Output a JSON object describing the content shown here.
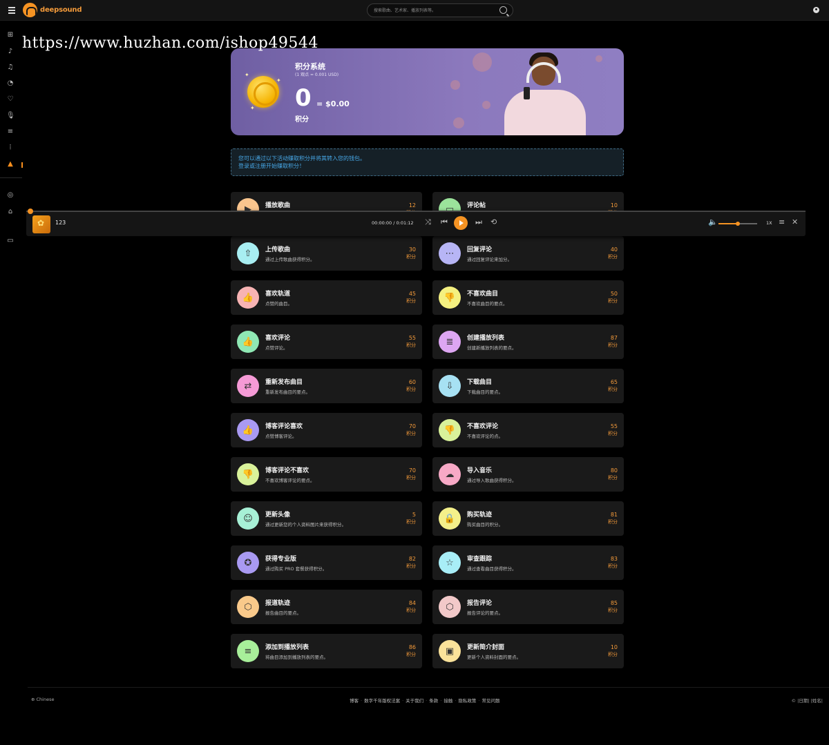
{
  "app": {
    "name": "deepsound"
  },
  "search": {
    "placeholder": "搜索歌曲、艺术家、播放列表等。"
  },
  "watermark": "https://www.huzhan.com/ishop49544",
  "hero": {
    "title": "积分系统",
    "subtitle": "(1 观点 = 0.001 USD)",
    "points": "0",
    "usd": "= $0.00",
    "label": "积分"
  },
  "info": {
    "line1": "您可以通过以下活动赚取积分并将其转入您的钱包。",
    "line2": "登录或注册开始赚取积分！"
  },
  "cards": [
    {
      "title": "播放歌曲",
      "desc": "",
      "points": "12",
      "unit": "积分",
      "icon": "play-icon",
      "color": "#f9c58e"
    },
    {
      "title": "评论帖",
      "desc": "",
      "points": "10",
      "unit": "积分",
      "icon": "comment-icon",
      "color": "#9be39b"
    },
    {
      "title": "上传歌曲",
      "desc": "通过上传歌曲获得积分。",
      "points": "30",
      "unit": "积分",
      "icon": "upload-icon",
      "color": "#a8eef2"
    },
    {
      "title": "回复评论",
      "desc": "通过回复评论来加分。",
      "points": "40",
      "unit": "积分",
      "icon": "reply-icon",
      "color": "#b7b5f5"
    },
    {
      "title": "喜欢轨道",
      "desc": "点赞的曲目。",
      "points": "45",
      "unit": "积分",
      "icon": "thumbs-up-icon",
      "color": "#f7b3b3"
    },
    {
      "title": "不喜欢曲目",
      "desc": "不喜欢曲目的要点。",
      "points": "50",
      "unit": "积分",
      "icon": "thumbs-down-icon",
      "color": "#f4f080"
    },
    {
      "title": "喜欢评论",
      "desc": "点赞评论。",
      "points": "55",
      "unit": "积分",
      "icon": "thumbs-up-icon",
      "color": "#8fe8b4"
    },
    {
      "title": "创建播放列表",
      "desc": "创建新播放列表的要点。",
      "points": "87",
      "unit": "积分",
      "icon": "playlist-icon",
      "color": "#dda6f2"
    },
    {
      "title": "重新发布曲目",
      "desc": "重新发布曲目的要点。",
      "points": "60",
      "unit": "积分",
      "icon": "repost-icon",
      "color": "#f59ad6"
    },
    {
      "title": "下载曲目",
      "desc": "下载曲目的要点。",
      "points": "65",
      "unit": "积分",
      "icon": "download-icon",
      "color": "#a7e1f3"
    },
    {
      "title": "博客评论喜欢",
      "desc": "点赞博客评论。",
      "points": "70",
      "unit": "积分",
      "icon": "thumbs-up-icon",
      "color": "#a99af2"
    },
    {
      "title": "不喜欢评论",
      "desc": "不喜欢评论的点。",
      "points": "55",
      "unit": "积分",
      "icon": "thumbs-down-icon",
      "color": "#d9f29a"
    },
    {
      "title": "博客评论不喜欢",
      "desc": "不喜欢博客评论的要点。",
      "points": "70",
      "unit": "积分",
      "icon": "thumbs-down-icon",
      "color": "#d9f29a"
    },
    {
      "title": "导入音乐",
      "desc": "通过导入歌曲获得积分。",
      "points": "80",
      "unit": "积分",
      "icon": "cloud-upload-icon",
      "color": "#f7a9c6"
    },
    {
      "title": "更新头像",
      "desc": "通过更新您的个人资料图片来获得积分。",
      "points": "5",
      "unit": "积分",
      "icon": "avatar-icon",
      "color": "#a7f0d6"
    },
    {
      "title": "购买轨迹",
      "desc": "购买曲目的积分。",
      "points": "81",
      "unit": "积分",
      "icon": "lock-icon",
      "color": "#f4f08a"
    },
    {
      "title": "获得专业版",
      "desc": "通过购买 PRO 套餐获得积分。",
      "points": "82",
      "unit": "积分",
      "icon": "medal-icon",
      "color": "#a99af2"
    },
    {
      "title": "审查跟踪",
      "desc": "通过查看曲目获得积分。",
      "points": "83",
      "unit": "积分",
      "icon": "star-icon",
      "color": "#a8eef7"
    },
    {
      "title": "报道轨迹",
      "desc": "报告曲目的要点。",
      "points": "84",
      "unit": "积分",
      "icon": "report-icon",
      "color": "#f9c98a"
    },
    {
      "title": "报告评论",
      "desc": "报告评论的要点。",
      "points": "85",
      "unit": "积分",
      "icon": "report-icon",
      "color": "#f2c9c9"
    },
    {
      "title": "添加到播放列表",
      "desc": "将曲目添加到播放列表的要点。",
      "points": "86",
      "unit": "积分",
      "icon": "add-playlist-icon",
      "color": "#a8ef9a"
    },
    {
      "title": "更新简介封面",
      "desc": "更新个人资料封面的要点。",
      "points": "10",
      "unit": "积分",
      "icon": "image-icon",
      "color": "#fae29a"
    }
  ],
  "player": {
    "song": "123",
    "time": "00:00:00 / 0:01:12",
    "progress": 0,
    "volume": 0.5,
    "speed": "1X"
  },
  "footer": {
    "language": "Chinese",
    "links": [
      "博客",
      "数字千年版权法案",
      "关于我们",
      "条款",
      "接触",
      "隐私政策",
      "常见问题"
    ],
    "copyright": "© |日期| |姓名|"
  }
}
